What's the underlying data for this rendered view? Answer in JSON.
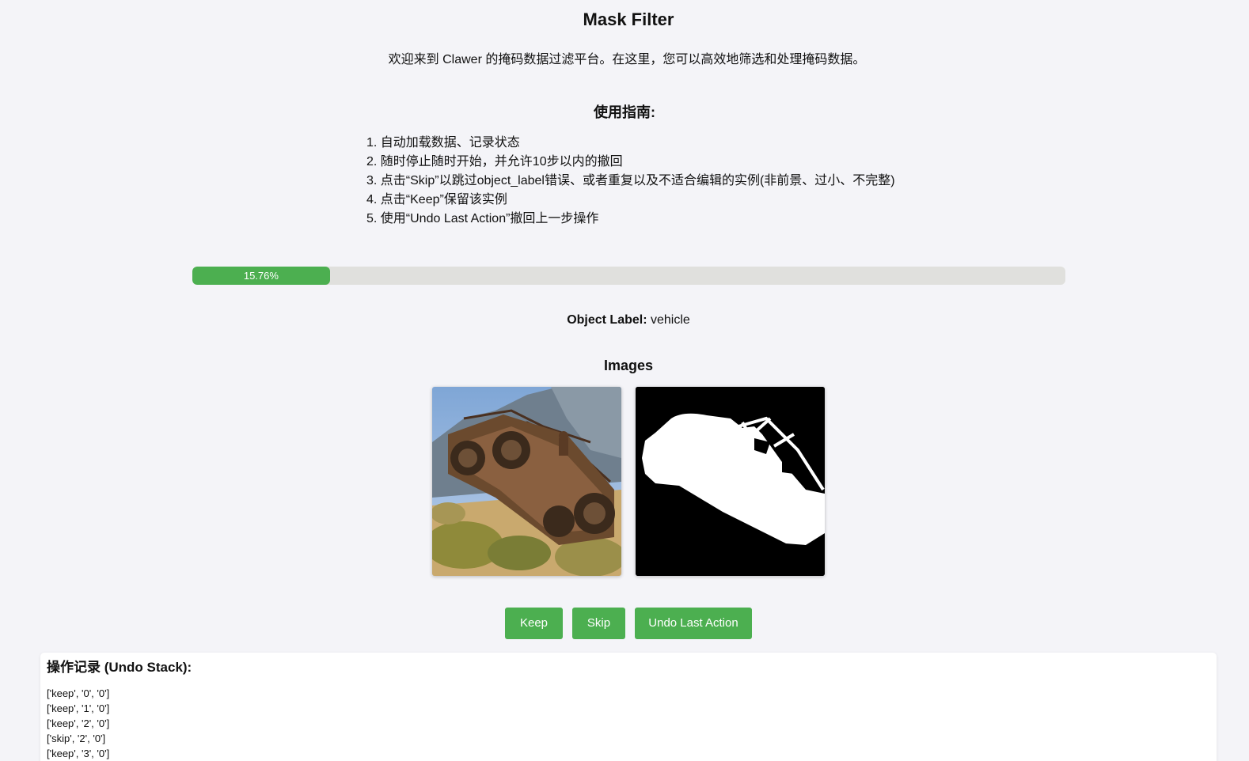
{
  "title": "Mask Filter",
  "welcome": "欢迎来到 Clawer 的掩码数据过滤平台。在这里，您可以高效地筛选和处理掩码数据。",
  "guide": {
    "title": "使用指南:",
    "items": [
      "1. 自动加载数据、记录状态",
      "2. 随时停止随时开始，并允许10步以内的撤回",
      "3. 点击“Skip”以跳过object_label错误、或者重复以及不适合编辑的实例(非前景、过小、不完整)",
      "4. 点击“Keep”保留该实例",
      "5. 使用“Undo Last Action”撤回上一步操作"
    ]
  },
  "progress": {
    "value": 15.76,
    "label": "15.76%",
    "color": "#4caf50"
  },
  "object": {
    "label_key": "Object Label:",
    "label_value": "vehicle"
  },
  "images": {
    "title": "Images"
  },
  "buttons": {
    "keep": "Keep",
    "skip": "Skip",
    "undo": "Undo Last Action",
    "color": "#4caf50"
  },
  "undo_stack": {
    "title": "操作记录 (Undo Stack):",
    "entries": [
      "['keep', '0', '0']",
      "['keep', '1', '0']",
      "['keep', '2', '0']",
      "['skip', '2', '0']",
      "['keep', '3', '0']"
    ]
  }
}
